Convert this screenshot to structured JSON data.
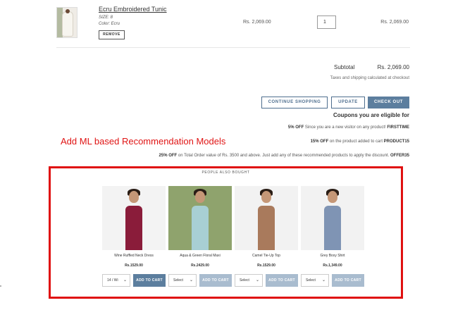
{
  "cart": {
    "item": {
      "title": "Ecru Embroidered Tunic",
      "size": "SIZE: 8",
      "color": "Color: Ecru",
      "remove_label": "REMOVE",
      "unit_price": "Rs. 2,069.00",
      "quantity": "1",
      "line_total": "Rs. 2,069.00"
    }
  },
  "summary": {
    "subtotal_label": "Subtotal",
    "subtotal_value": "Rs. 2,069.00",
    "tax_note": "Taxes and shipping calculated at checkout"
  },
  "buttons": {
    "continue_shopping": "CONTINUE SHOPPING",
    "update": "UPDATE",
    "checkout": "CHECK OUT"
  },
  "coupons": {
    "title": "Coupons you are eligible for",
    "list": [
      {
        "discount": "5% OFF",
        "text": " Since you are a new visitor on any product! ",
        "code": "FIRSTTIME"
      },
      {
        "discount": "15% OFF",
        "text": " on the product added to cart ",
        "code": "PRODUCT15"
      },
      {
        "discount": "25% OFF",
        "text": " on Total Order value of Rs. 3500 and above. Just add any of these recommended products to apply the discount. ",
        "code": "OFFER35"
      }
    ]
  },
  "annotation": "Add ML based Recommendation Models",
  "recommendations": {
    "heading": "PEOPLE ALSO BOUGHT",
    "items": [
      {
        "name": "Wine Ruffled Neck Dress",
        "price": "Rs.1529.00",
        "select": "14 / Wi",
        "add_label": "ADD TO CART",
        "state": "active",
        "color": "#8a1c3a",
        "bg": "#f3f3f3"
      },
      {
        "name": "Aqua & Green Floral Maxi",
        "price": "Rs.2429.00",
        "select": "Select",
        "add_label": "ADD TO CART",
        "state": "disabled",
        "color": "#a8cfd4",
        "bg": "#8fa36d"
      },
      {
        "name": "Camel Tie-Up Top",
        "price": "Rs.1529.00",
        "select": "Select",
        "add_label": "ADD TO CART",
        "state": "disabled",
        "color": "#a97a5c",
        "bg": "#f2f2f2"
      },
      {
        "name": "Grey Boxy Shirt",
        "price": "Rs.1,349.00",
        "select": "Select",
        "add_label": "ADD TO CART",
        "state": "disabled",
        "color": "#7f94b4",
        "bg": "#f2f2f2"
      }
    ]
  }
}
